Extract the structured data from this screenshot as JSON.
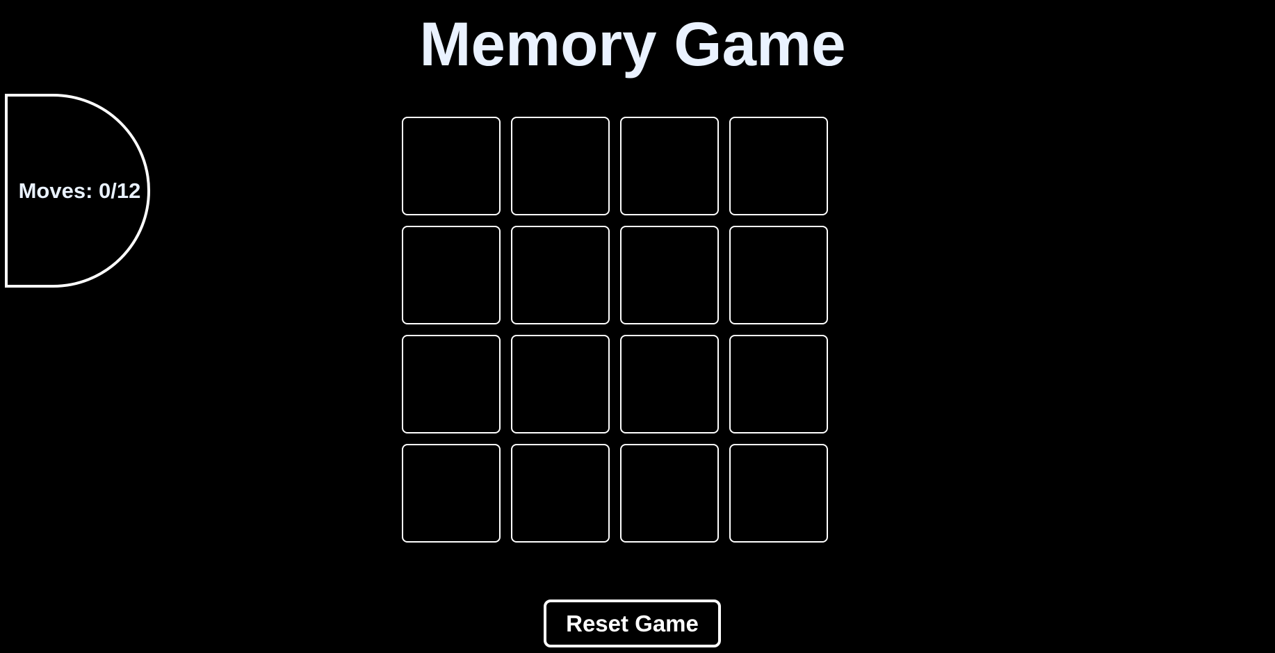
{
  "game": {
    "title": "Memory Game",
    "moves_label": "Moves: 0/12",
    "reset_label": "Reset Game",
    "board": {
      "rows": 4,
      "columns": 4,
      "cards": [
        {
          "state": "face-down"
        },
        {
          "state": "face-down"
        },
        {
          "state": "face-down"
        },
        {
          "state": "face-down"
        },
        {
          "state": "face-down"
        },
        {
          "state": "face-down"
        },
        {
          "state": "face-down"
        },
        {
          "state": "face-down"
        },
        {
          "state": "face-down"
        },
        {
          "state": "face-down"
        },
        {
          "state": "face-down"
        },
        {
          "state": "face-down"
        },
        {
          "state": "face-down"
        },
        {
          "state": "face-down"
        },
        {
          "state": "face-down"
        },
        {
          "state": "face-down"
        }
      ]
    }
  },
  "colors": {
    "background": "#000000",
    "foreground": "#ffffff",
    "title": "#eaf2ff"
  }
}
